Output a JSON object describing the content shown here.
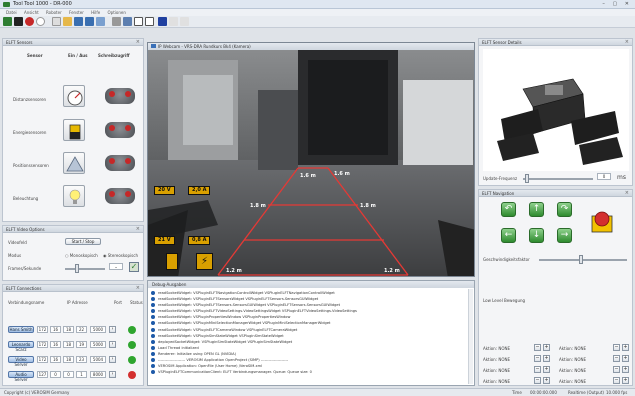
{
  "window": {
    "title": "Tool Tool 1000 - DR-000"
  },
  "menu": [
    "Datei",
    "Ansicht",
    "Roboter",
    "Fenster",
    "Hilfe",
    "Optionen"
  ],
  "sensors_panel": {
    "title": "ELFT Sensors",
    "headers": {
      "sensor": "Sensor",
      "an_aus": "Ein / Aus",
      "schreibzugriff": "Schreibzugriff"
    },
    "rows": [
      {
        "label": "Distanzsensoren",
        "icon": "gauge-icon"
      },
      {
        "label": "Energiesensoren",
        "icon": "battery-icon"
      },
      {
        "label": "Positionssensoren",
        "icon": "pyramid-icon"
      },
      {
        "label": "Beleuchtung",
        "icon": "lightbulb-icon"
      }
    ]
  },
  "video_panel": {
    "title": "ELFT Video Options",
    "screenshot_label": "Videofeld",
    "screenshot_button": "Start / Stop",
    "mode_label": "Modus",
    "mode_options": [
      "Monoskopisch",
      "Stereoskopisch"
    ],
    "speed_label": "Frames/Sekunde"
  },
  "connections_panel": {
    "title": "ELFT Connections",
    "headers": {
      "name": "Verbindungsname",
      "ip": "IP Adresse",
      "port": "Port",
      "status": "Status"
    },
    "rows": [
      {
        "name": "Hans Smith",
        "ip": [
          "172",
          "16",
          "18",
          "22"
        ],
        "port": "5000",
        "status_color": "#2fa52f"
      },
      {
        "name": "Leonardo Scarz",
        "ip": [
          "172",
          "16",
          "18",
          "19"
        ],
        "port": "5000",
        "status_color": "#2fa52f"
      },
      {
        "name": "Video Server",
        "ip": [
          "172",
          "16",
          "18",
          "23"
        ],
        "port": "5004",
        "status_color": "#2fa52f"
      },
      {
        "name": "Audio Server",
        "ip": [
          "127",
          "0",
          "0",
          "1"
        ],
        "port": "8000",
        "status_color": "#d32f2f"
      }
    ]
  },
  "camera": {
    "title": "IP Webcam - VRS-DRA Rundkurs Bk4 (Kamera)",
    "overlay_voltage_top": "20 V",
    "overlay_current_top": "2,0 A",
    "overlay_voltage_bottom": "21 V",
    "overlay_current_bottom": "0,8 A",
    "distances": {
      "far_left": "1.6 m",
      "far_right": "1.6 m",
      "mid_left": "1.8 m",
      "mid_right": "1.8 m",
      "near_left": "1.2 m",
      "near_right": "1.2 m"
    }
  },
  "log": {
    "title": "Debug-Ausgaben",
    "lines": [
      "readSocketWidget: VSPluginELFTNavigationControllWidget  VSPluginELFTNavigationControllWidget",
      "readSocketWidget: VSPluginELFTSensorsWidget  VSPluginELFTSensors.SensorsGUIWidget",
      "readSocketWidget: VSPluginELFTSensors.SensorsGUIWidget  VSPluginELFTSensors.SensorsGUIWidget",
      "readSocketWidget: VSPluginELFTVideoSettings.VideoSettingsWidget  VSPluginELFTVideoSettings.VideoSettings",
      "readSocketWidget: VSPluginPropertiesWindow  VSPluginPropertiesWindow",
      "readSocketWidget: VSPluginMiniSelectionManagerWidget  VSPluginMiniSelectionManagerWidget",
      "readSocketWidget: VSPluginELFTCameraWindow  VSPluginELFTCameraWidget",
      "readSocketWidget: VSPluginSimStateWidget  VSPluginSimStateWidget",
      "deployedSocketWidget: VSPluginSimStateWidget  VSPluginSimStateWidget",
      "Load Thread initialized",
      "Renderer: Initialize using OPEN GL (NVIDIA)",
      "--------------------- VEROSIM Application OpenProject (SIMP) ---------------------",
      "VEROSIM Application: OpenFile (User Home) /VeroSIM.xml",
      "VSPluginELFTCommunicationClient: ELFT Verbindungsmanager. Queue: Queue size: 0"
    ]
  },
  "sensor_details": {
    "title": "ELFT Sensor Details",
    "update_label": "Update-Frequenz",
    "update_value": "0",
    "update_unit": "ms"
  },
  "navigation": {
    "title": "ELFT Navigation",
    "speed_label": "Geschwindigkeitsfaktor",
    "movement_label": "Low Level Bewegung",
    "actions": [
      {
        "left": "Aktion: NONE",
        "right": "Aktion: NONE"
      },
      {
        "left": "Aktion: NONE",
        "right": "Aktion: NONE"
      },
      {
        "left": "Aktion: NONE",
        "right": "Aktion: NONE"
      },
      {
        "left": "Aktion: NONE",
        "right": "Aktion: NONE"
      }
    ]
  },
  "status_bar": {
    "left": "Copyright (c)  VEROSIM  Germany",
    "center": "Time",
    "time": "00:00:00.000",
    "sim": "Realtime (Output)",
    "fps": "10.000 fps"
  }
}
